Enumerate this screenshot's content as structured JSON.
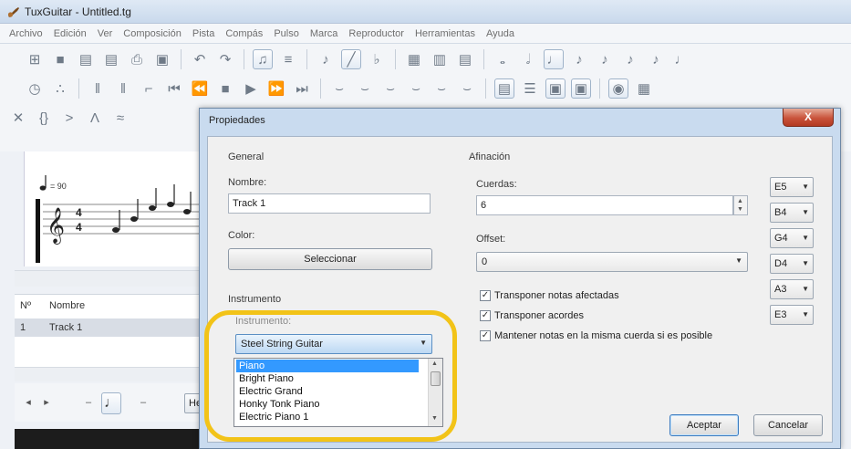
{
  "window": {
    "title": "TuxGuitar - Untitled.tg"
  },
  "menu": [
    "Archivo",
    "Edición",
    "Ver",
    "Composición",
    "Pista",
    "Compás",
    "Pulso",
    "Marca",
    "Reproductor",
    "Herramientas",
    "Ayuda"
  ],
  "score": {
    "tempo": "= 90"
  },
  "tracks_table": {
    "headers": [
      "Nº",
      "Nombre"
    ],
    "rows": [
      {
        "number": "1",
        "name": "Track 1"
      }
    ]
  },
  "bottom_controls": {
    "he_label": "He"
  },
  "dialog": {
    "title": "Propiedades",
    "close_label": "X",
    "general": {
      "section_title": "General",
      "name_label": "Nombre:",
      "name_value": "Track 1",
      "color_label": "Color:",
      "select_button": "Seleccionar"
    },
    "instrument": {
      "section_title": "Instrumento",
      "field_label": "Instrumento:",
      "selected": "Steel String Guitar",
      "options": [
        "Piano",
        "Bright Piano",
        "Electric Grand",
        "Honky Tonk Piano",
        "Electric Piano 1"
      ],
      "highlighted_option": "Piano"
    },
    "tuning": {
      "section_title": "Afinación",
      "strings_label": "Cuerdas:",
      "strings_value": "6",
      "offset_label": "Offset:",
      "offset_value": "0",
      "checkboxes": [
        {
          "label": "Transponer notas afectadas",
          "checked": true
        },
        {
          "label": "Transponer acordes",
          "checked": true
        },
        {
          "label": "Mantener notas en la misma cuerda si es posible",
          "checked": true
        }
      ],
      "string_notes": [
        "E5",
        "B4",
        "G4",
        "D4",
        "A3",
        "E3"
      ]
    },
    "buttons": {
      "accept": "Aceptar",
      "cancel": "Cancelar"
    }
  }
}
